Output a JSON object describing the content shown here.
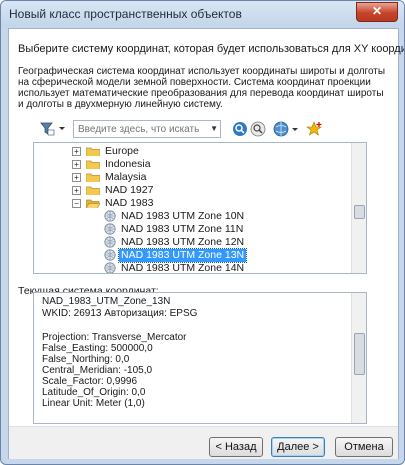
{
  "window": {
    "title": "Новый класс пространственных объектов",
    "close_glyph": "✕"
  },
  "intro": "Выберите систему координат, которая будет использоваться для XY координат.",
  "description": "Географическая система координат использует координаты широты и долготы на сферической модели земной поверхности. Система координат проекции использует математические преобразования для перевода координат широты и долготы в двухмерную линейную систему.",
  "toolbar": {
    "search_placeholder": "Введите здесь, что искать",
    "icons": [
      "filter-icon",
      "search-icon",
      "clear-search-icon",
      "globe-add-icon",
      "favorite-add-icon"
    ]
  },
  "tree": {
    "items": [
      {
        "label": "Europe",
        "type": "folder",
        "expander": "+"
      },
      {
        "label": "Indonesia",
        "type": "folder",
        "expander": "+"
      },
      {
        "label": "Malaysia",
        "type": "folder",
        "expander": "+"
      },
      {
        "label": "NAD 1927",
        "type": "folder",
        "expander": "+"
      },
      {
        "label": "NAD 1983",
        "type": "folder-open",
        "expander": "−"
      },
      {
        "label": "NAD 1983 UTM Zone 10N",
        "type": "crs"
      },
      {
        "label": "NAD 1983 UTM Zone 11N",
        "type": "crs"
      },
      {
        "label": "NAD 1983 UTM Zone 12N",
        "type": "crs"
      },
      {
        "label": "NAD 1983 UTM Zone 13N",
        "type": "crs",
        "selected": true
      },
      {
        "label": "NAD 1983 UTM Zone 14N",
        "type": "crs"
      }
    ]
  },
  "current": {
    "label": "Текущая система координат:",
    "lines": [
      "NAD_1983_UTM_Zone_13N",
      "WKID: 26913 Авторизация: EPSG",
      "",
      "Projection: Transverse_Mercator",
      "False_Easting: 500000,0",
      "False_Northing: 0,0",
      "Central_Meridian: -105,0",
      "Scale_Factor: 0,9996",
      "Latitude_Of_Origin: 0,0",
      "Linear Unit: Meter (1,0)"
    ]
  },
  "buttons": {
    "back": "< Назад",
    "next": "Далее >",
    "cancel": "Отмена"
  },
  "colors": {
    "selection": "#3399ff",
    "folder": "#f2c94c",
    "frame": "#c6d7ec"
  }
}
